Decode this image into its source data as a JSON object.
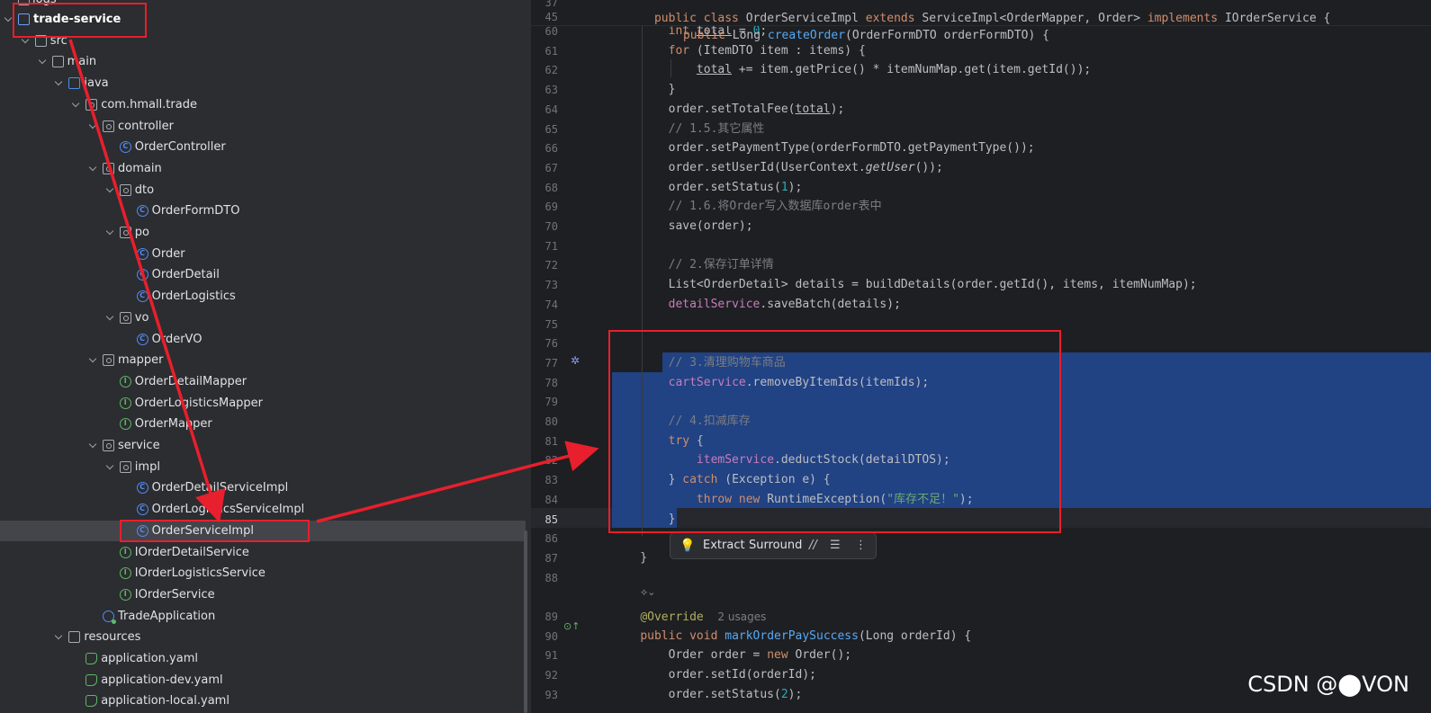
{
  "tree": {
    "top_partial": "logs",
    "items": [
      {
        "label": "trade-service",
        "icon": "module-folder-icon",
        "depth": 0,
        "bold": true
      },
      {
        "label": "src",
        "icon": "folder-icon",
        "depth": 1
      },
      {
        "label": "main",
        "icon": "folder-icon",
        "depth": 2
      },
      {
        "label": "java",
        "icon": "source-root-folder-icon",
        "depth": 3
      },
      {
        "label": "com.hmall.trade",
        "icon": "package-icon",
        "depth": 4
      },
      {
        "label": "controller",
        "icon": "package-icon",
        "depth": 5
      },
      {
        "label": "OrderController",
        "icon": "class-icon",
        "depth": 6
      },
      {
        "label": "domain",
        "icon": "package-icon",
        "depth": 5
      },
      {
        "label": "dto",
        "icon": "package-icon",
        "depth": 6
      },
      {
        "label": "OrderFormDTO",
        "icon": "class-icon",
        "depth": 7
      },
      {
        "label": "po",
        "icon": "package-icon",
        "depth": 6
      },
      {
        "label": "Order",
        "icon": "class-icon",
        "depth": 7
      },
      {
        "label": "OrderDetail",
        "icon": "class-icon",
        "depth": 7
      },
      {
        "label": "OrderLogistics",
        "icon": "class-icon",
        "depth": 7
      },
      {
        "label": "vo",
        "icon": "package-icon",
        "depth": 6
      },
      {
        "label": "OrderVO",
        "icon": "class-icon",
        "depth": 7
      },
      {
        "label": "mapper",
        "icon": "package-icon",
        "depth": 5
      },
      {
        "label": "OrderDetailMapper",
        "icon": "interface-icon",
        "depth": 6
      },
      {
        "label": "OrderLogisticsMapper",
        "icon": "interface-icon",
        "depth": 6
      },
      {
        "label": "OrderMapper",
        "icon": "interface-icon",
        "depth": 6
      },
      {
        "label": "service",
        "icon": "package-icon",
        "depth": 5
      },
      {
        "label": "impl",
        "icon": "package-icon",
        "depth": 6
      },
      {
        "label": "OrderDetailServiceImpl",
        "icon": "class-icon",
        "depth": 7
      },
      {
        "label": "OrderLogisticsServiceImpl",
        "icon": "class-icon",
        "depth": 7
      },
      {
        "label": "OrderServiceImpl",
        "icon": "class-icon",
        "depth": 7,
        "selected": true
      },
      {
        "label": "IOrderDetailService",
        "icon": "interface-icon",
        "depth": 6
      },
      {
        "label": "IOrderLogisticsService",
        "icon": "interface-icon",
        "depth": 6
      },
      {
        "label": "IOrderService",
        "icon": "interface-icon",
        "depth": 6
      },
      {
        "label": "TradeApplication",
        "icon": "spring-app-icon",
        "depth": 5
      },
      {
        "label": "resources",
        "icon": "resources-folder-icon",
        "depth": 3
      },
      {
        "label": "application.yaml",
        "icon": "yaml-icon",
        "depth": 4
      },
      {
        "label": "application-dev.yaml",
        "icon": "yaml-icon",
        "depth": 4
      },
      {
        "label": "application-local.yaml",
        "icon": "yaml-icon",
        "depth": 4
      }
    ]
  },
  "editor": {
    "sticky_header": [
      "public class OrderServiceImpl extends ServiceImpl<OrderMapper, Order> implements IOrderService {",
      "    public Long createOrder(OrderFormDTO orderFormDTO) {"
    ],
    "sticky_numbers": [
      "37",
      "45"
    ],
    "lines": [
      {
        "n": "60",
        "text": "        int total = 0;"
      },
      {
        "n": "61",
        "text": "        for (ItemDTO item : items) {"
      },
      {
        "n": "62",
        "text": "            total += item.getPrice() * itemNumMap.get(item.getId());"
      },
      {
        "n": "63",
        "text": "        }"
      },
      {
        "n": "64",
        "text": "        order.setTotalFee(total);"
      },
      {
        "n": "65",
        "text": "        // 1.5.其它属性"
      },
      {
        "n": "66",
        "text": "        order.setPaymentType(orderFormDTO.getPaymentType());"
      },
      {
        "n": "67",
        "text": "        order.setUserId(UserContext.getUser());"
      },
      {
        "n": "68",
        "text": "        order.setStatus(1);"
      },
      {
        "n": "69",
        "text": "        // 1.6.将Order写入数据库order表中"
      },
      {
        "n": "70",
        "text": "        save(order);"
      },
      {
        "n": "71",
        "text": ""
      },
      {
        "n": "72",
        "text": "        // 2.保存订单详情"
      },
      {
        "n": "73",
        "text": "        List<OrderDetail> details = buildDetails(order.getId(), items, itemNumMap);"
      },
      {
        "n": "74",
        "text": "        detailService.saveBatch(details);"
      },
      {
        "n": "75",
        "text": ""
      },
      {
        "n": "76",
        "text": ""
      },
      {
        "n": "77",
        "text": "        // 3.清理购物车商品"
      },
      {
        "n": "78",
        "text": "        cartService.removeByItemIds(itemIds);"
      },
      {
        "n": "79",
        "text": ""
      },
      {
        "n": "80",
        "text": "        // 4.扣减库存"
      },
      {
        "n": "81",
        "text": "        try {"
      },
      {
        "n": "82",
        "text": "            itemService.deductStock(detailDTOS);"
      },
      {
        "n": "83",
        "text": "        } catch (Exception e) {"
      },
      {
        "n": "84",
        "text": "            throw new RuntimeException(\"库存不足！\");"
      },
      {
        "n": "85",
        "text": "        }"
      },
      {
        "n": "86",
        "text": ""
      },
      {
        "n": "87",
        "text": "    }"
      },
      {
        "n": "88",
        "text": ""
      },
      {
        "n": "",
        "text": ""
      },
      {
        "n": "89",
        "text": "    @Override  2 usages"
      },
      {
        "n": "90",
        "text": "    public void markOrderPaySuccess(Long orderId) {"
      },
      {
        "n": "91",
        "text": "        Order order = new Order();"
      },
      {
        "n": "92",
        "text": "        order.setId(orderId);"
      },
      {
        "n": "93",
        "text": "        order.setStatus(2);"
      }
    ],
    "popup": {
      "extract": "Extract",
      "surround": "Surround"
    }
  },
  "watermark": "CSDN @⬤VON",
  "colors": {
    "annotation_red": "#e81f2c",
    "selection": "#214283"
  }
}
